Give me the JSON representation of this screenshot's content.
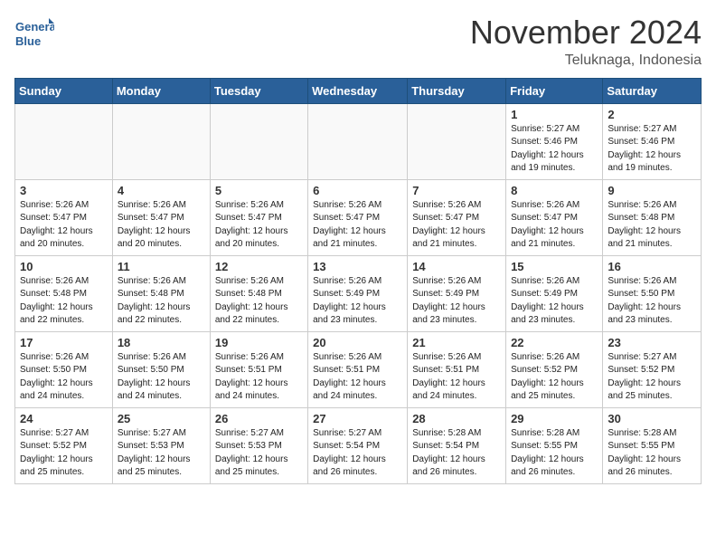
{
  "header": {
    "logo_top": "General",
    "logo_bottom": "Blue",
    "month": "November 2024",
    "location": "Teluknaga, Indonesia"
  },
  "days_of_week": [
    "Sunday",
    "Monday",
    "Tuesday",
    "Wednesday",
    "Thursday",
    "Friday",
    "Saturday"
  ],
  "weeks": [
    [
      {
        "day": "",
        "info": ""
      },
      {
        "day": "",
        "info": ""
      },
      {
        "day": "",
        "info": ""
      },
      {
        "day": "",
        "info": ""
      },
      {
        "day": "",
        "info": ""
      },
      {
        "day": "1",
        "info": "Sunrise: 5:27 AM\nSunset: 5:46 PM\nDaylight: 12 hours\nand 19 minutes."
      },
      {
        "day": "2",
        "info": "Sunrise: 5:27 AM\nSunset: 5:46 PM\nDaylight: 12 hours\nand 19 minutes."
      }
    ],
    [
      {
        "day": "3",
        "info": "Sunrise: 5:26 AM\nSunset: 5:47 PM\nDaylight: 12 hours\nand 20 minutes."
      },
      {
        "day": "4",
        "info": "Sunrise: 5:26 AM\nSunset: 5:47 PM\nDaylight: 12 hours\nand 20 minutes."
      },
      {
        "day": "5",
        "info": "Sunrise: 5:26 AM\nSunset: 5:47 PM\nDaylight: 12 hours\nand 20 minutes."
      },
      {
        "day": "6",
        "info": "Sunrise: 5:26 AM\nSunset: 5:47 PM\nDaylight: 12 hours\nand 21 minutes."
      },
      {
        "day": "7",
        "info": "Sunrise: 5:26 AM\nSunset: 5:47 PM\nDaylight: 12 hours\nand 21 minutes."
      },
      {
        "day": "8",
        "info": "Sunrise: 5:26 AM\nSunset: 5:47 PM\nDaylight: 12 hours\nand 21 minutes."
      },
      {
        "day": "9",
        "info": "Sunrise: 5:26 AM\nSunset: 5:48 PM\nDaylight: 12 hours\nand 21 minutes."
      }
    ],
    [
      {
        "day": "10",
        "info": "Sunrise: 5:26 AM\nSunset: 5:48 PM\nDaylight: 12 hours\nand 22 minutes."
      },
      {
        "day": "11",
        "info": "Sunrise: 5:26 AM\nSunset: 5:48 PM\nDaylight: 12 hours\nand 22 minutes."
      },
      {
        "day": "12",
        "info": "Sunrise: 5:26 AM\nSunset: 5:48 PM\nDaylight: 12 hours\nand 22 minutes."
      },
      {
        "day": "13",
        "info": "Sunrise: 5:26 AM\nSunset: 5:49 PM\nDaylight: 12 hours\nand 23 minutes."
      },
      {
        "day": "14",
        "info": "Sunrise: 5:26 AM\nSunset: 5:49 PM\nDaylight: 12 hours\nand 23 minutes."
      },
      {
        "day": "15",
        "info": "Sunrise: 5:26 AM\nSunset: 5:49 PM\nDaylight: 12 hours\nand 23 minutes."
      },
      {
        "day": "16",
        "info": "Sunrise: 5:26 AM\nSunset: 5:50 PM\nDaylight: 12 hours\nand 23 minutes."
      }
    ],
    [
      {
        "day": "17",
        "info": "Sunrise: 5:26 AM\nSunset: 5:50 PM\nDaylight: 12 hours\nand 24 minutes."
      },
      {
        "day": "18",
        "info": "Sunrise: 5:26 AM\nSunset: 5:50 PM\nDaylight: 12 hours\nand 24 minutes."
      },
      {
        "day": "19",
        "info": "Sunrise: 5:26 AM\nSunset: 5:51 PM\nDaylight: 12 hours\nand 24 minutes."
      },
      {
        "day": "20",
        "info": "Sunrise: 5:26 AM\nSunset: 5:51 PM\nDaylight: 12 hours\nand 24 minutes."
      },
      {
        "day": "21",
        "info": "Sunrise: 5:26 AM\nSunset: 5:51 PM\nDaylight: 12 hours\nand 24 minutes."
      },
      {
        "day": "22",
        "info": "Sunrise: 5:26 AM\nSunset: 5:52 PM\nDaylight: 12 hours\nand 25 minutes."
      },
      {
        "day": "23",
        "info": "Sunrise: 5:27 AM\nSunset: 5:52 PM\nDaylight: 12 hours\nand 25 minutes."
      }
    ],
    [
      {
        "day": "24",
        "info": "Sunrise: 5:27 AM\nSunset: 5:52 PM\nDaylight: 12 hours\nand 25 minutes."
      },
      {
        "day": "25",
        "info": "Sunrise: 5:27 AM\nSunset: 5:53 PM\nDaylight: 12 hours\nand 25 minutes."
      },
      {
        "day": "26",
        "info": "Sunrise: 5:27 AM\nSunset: 5:53 PM\nDaylight: 12 hours\nand 25 minutes."
      },
      {
        "day": "27",
        "info": "Sunrise: 5:27 AM\nSunset: 5:54 PM\nDaylight: 12 hours\nand 26 minutes."
      },
      {
        "day": "28",
        "info": "Sunrise: 5:28 AM\nSunset: 5:54 PM\nDaylight: 12 hours\nand 26 minutes."
      },
      {
        "day": "29",
        "info": "Sunrise: 5:28 AM\nSunset: 5:55 PM\nDaylight: 12 hours\nand 26 minutes."
      },
      {
        "day": "30",
        "info": "Sunrise: 5:28 AM\nSunset: 5:55 PM\nDaylight: 12 hours\nand 26 minutes."
      }
    ]
  ]
}
